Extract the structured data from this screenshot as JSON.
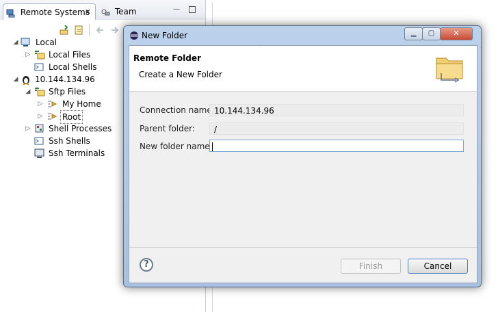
{
  "tabs": {
    "remote_systems": "Remote Systems",
    "team": "Team"
  },
  "tree": [
    {
      "label": "Local"
    },
    {
      "label": "Local Files"
    },
    {
      "label": "Local Shells"
    },
    {
      "label": "10.144.134.96"
    },
    {
      "label": "Sftp Files"
    },
    {
      "label": "My Home"
    },
    {
      "label": "Root"
    },
    {
      "label": "Shell Processes"
    },
    {
      "label": "Ssh Shells"
    },
    {
      "label": "Ssh Terminals"
    }
  ],
  "dialog": {
    "title": "New Folder",
    "header_title": "Remote Folder",
    "header_subtitle": "Create a New Folder",
    "connection_label": "Connection name:",
    "connection_value": "10.144.134.96",
    "parent_label": "Parent folder:",
    "parent_value": "/",
    "new_folder_label": "New folder name:",
    "new_folder_value": "",
    "help_glyph": "?",
    "finish_label": "Finish",
    "cancel_label": "Cancel"
  },
  "colors": {
    "dialog_frame": "#bcd1ea",
    "close_button": "#c84a34",
    "input_border": "#7aa3d6"
  }
}
